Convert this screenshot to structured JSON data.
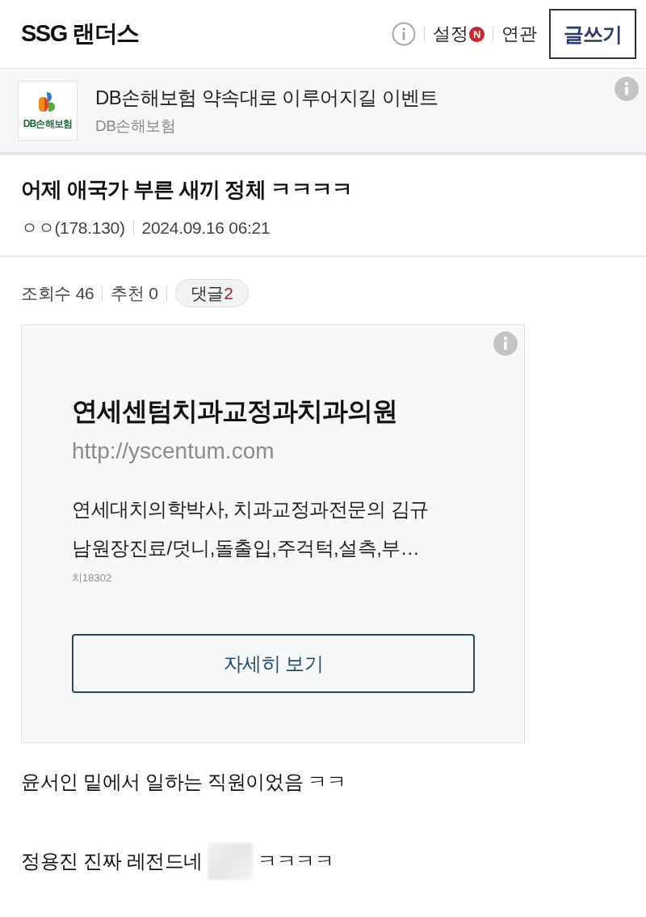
{
  "header": {
    "title": "SSG 랜더스",
    "links": [
      {
        "label": "설정",
        "badge": "N"
      },
      {
        "label": "연관"
      }
    ],
    "write_button": "글쓰기"
  },
  "sponsor": {
    "logo_text": "DB손해보험",
    "title": "DB손해보험 약속대로 이루어지길 이벤트",
    "advertiser": "DB손해보험"
  },
  "post": {
    "title": "어제 애국가 부른 새끼 정체 ㅋㅋㅋㅋ",
    "author": "ㅇㅇ(178.130)",
    "date": "2024.09.16 06:21",
    "stats": [
      "조회수 46",
      "추천 0"
    ],
    "comments": {
      "label": "댓글",
      "count": "2"
    }
  },
  "ad_card": {
    "title": "연세센텀치과교정과치과의원",
    "url": "http://yscentum.com",
    "description_lines": [
      "연세대치의학박사, 치과교정과전문의 김규",
      "남원장진료/덧니,돌출입,주걱턱,설측,부…"
    ],
    "code": "치18302",
    "button": "자세히 보기"
  },
  "body": [
    {
      "parts": [
        {
          "kind": "text",
          "text": "윤서인 밑에서 일하는 직원이었음 ㅋㅋ"
        }
      ]
    },
    {
      "parts": [
        {
          "kind": "text",
          "text": "정용진 진짜 레전드네"
        },
        {
          "kind": "redacted"
        },
        {
          "kind": "text",
          "text": "ㅋㅋㅋㅋ"
        }
      ]
    }
  ]
}
